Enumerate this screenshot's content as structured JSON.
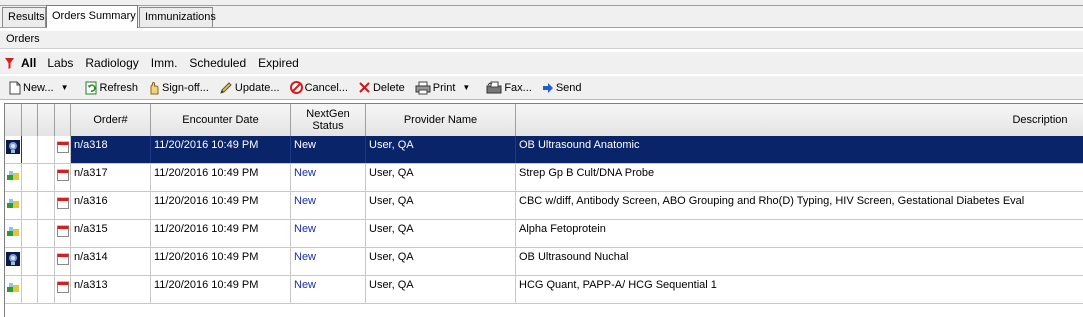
{
  "tabs": [
    {
      "label": "Results"
    },
    {
      "label": "Orders Summary",
      "active": true
    },
    {
      "label": "Immunizations"
    }
  ],
  "orders_title": "Orders",
  "filters": {
    "icon": "funnel-icon",
    "items": [
      "All",
      "Labs",
      "Radiology",
      "Imm.",
      "Scheduled",
      "Expired"
    ],
    "selected": "All"
  },
  "toolbar": {
    "new_label": "New...",
    "refresh_label": "Refresh",
    "signoff_label": "Sign-off...",
    "update_label": "Update...",
    "cancel_label": "Cancel...",
    "delete_label": "Delete",
    "print_label": "Print",
    "fax_label": "Fax...",
    "send_label": "Send"
  },
  "columns": {
    "order": "Order#",
    "encounter_date": "Encounter Date",
    "nextgen_status_line1": "NextGen",
    "nextgen_status_line2": "Status",
    "provider": "Provider Name",
    "description": "Description"
  },
  "rows": [
    {
      "type_icon": "ultrasound-icon",
      "order": "n/a318",
      "date": "11/20/2016 10:49 PM",
      "status": "New",
      "provider": "User, QA",
      "description": "OB Ultrasound Anatomic",
      "selected": true
    },
    {
      "type_icon": "lab-icon",
      "order": "n/a317",
      "date": "11/20/2016 10:49 PM",
      "status": "New",
      "provider": "User, QA",
      "description": "Strep Gp B Cult/DNA Probe",
      "selected": false
    },
    {
      "type_icon": "lab-icon",
      "order": "n/a316",
      "date": "11/20/2016 10:49 PM",
      "status": "New",
      "provider": "User, QA",
      "description": "CBC w/diff, Antibody Screen, ABO Grouping and Rho(D) Typing, HIV Screen, Gestational Diabetes Eval",
      "selected": false
    },
    {
      "type_icon": "lab-icon",
      "order": "n/a315",
      "date": "11/20/2016 10:49 PM",
      "status": "New",
      "provider": "User, QA",
      "description": "Alpha Fetoprotein",
      "selected": false
    },
    {
      "type_icon": "ultrasound-icon",
      "order": "n/a314",
      "date": "11/20/2016 10:49 PM",
      "status": "New",
      "provider": "User, QA",
      "description": "OB Ultrasound Nuchal",
      "selected": false
    },
    {
      "type_icon": "lab-icon",
      "order": "n/a313",
      "date": "11/20/2016 10:49 PM",
      "status": "New",
      "provider": "User, QA",
      "description": "HCG Quant, PAPP-A/ HCG Sequential 1",
      "selected": false
    }
  ],
  "colors": {
    "selection": "#0a246a",
    "status_new": "#1a2fa8",
    "window_bg": "#f0f0f0"
  }
}
